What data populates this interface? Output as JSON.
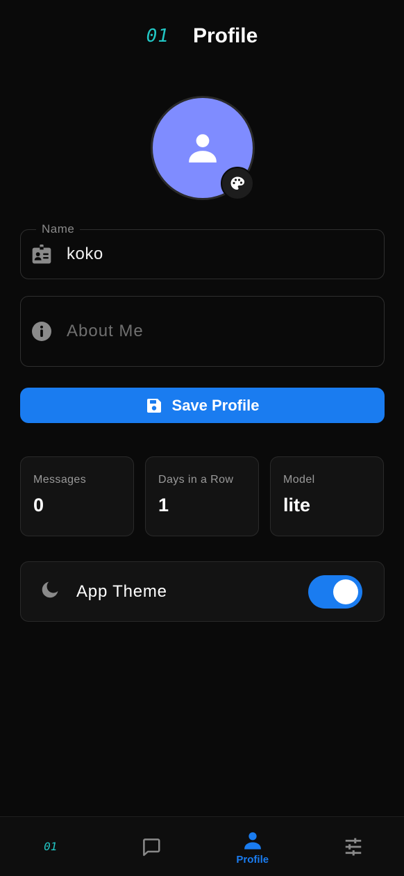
{
  "header": {
    "logo_text": "01",
    "title": "Profile"
  },
  "profile_form": {
    "name_label": "Name",
    "name_value": "koko",
    "about_placeholder": "About Me",
    "save_label": "Save Profile"
  },
  "stats": [
    {
      "label": "Messages",
      "value": "0"
    },
    {
      "label": "Days in a Row",
      "value": "1"
    },
    {
      "label": "Model",
      "value": "lite"
    }
  ],
  "theme": {
    "label": "App Theme",
    "enabled": true,
    "icon": "moon-icon"
  },
  "bottom_nav": {
    "home_logo": "01",
    "chat_icon": "chat-icon",
    "profile_label": "Profile",
    "settings_icon": "sliders-icon"
  },
  "colors": {
    "background": "#0a0a0a",
    "accent": "#1a7cf0",
    "logo": "#22c6c4",
    "avatar": "#7f8cff"
  }
}
